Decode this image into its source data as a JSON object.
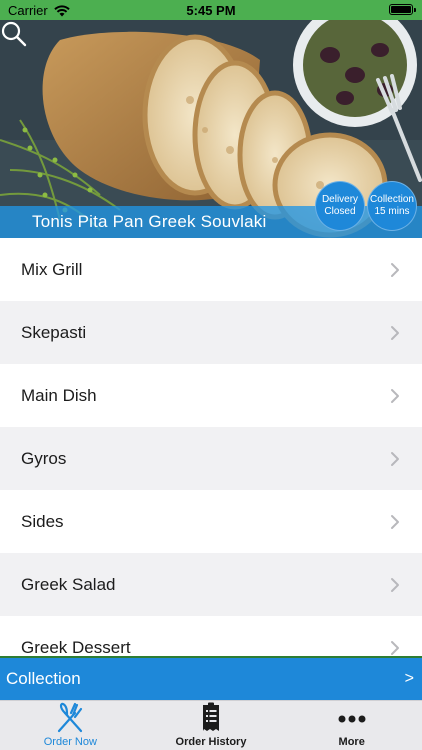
{
  "status_bar": {
    "carrier": "Carrier",
    "time": "5:45 PM",
    "battery_level": 1.0
  },
  "hero": {
    "restaurant_name": "Tonis Pita Pan Greek Souvlaki",
    "search_icon": "search-icon",
    "delivery_status": {
      "line1": "Delivery",
      "line2": "Closed"
    },
    "collection_status": {
      "line1": "Collection",
      "line2": "15 mins"
    }
  },
  "menu": {
    "categories": [
      {
        "label": "Mix Grill"
      },
      {
        "label": "Skepasti"
      },
      {
        "label": "Main Dish"
      },
      {
        "label": "Gyros"
      },
      {
        "label": "Sides"
      },
      {
        "label": "Greek Salad"
      },
      {
        "label": "Greek Dessert"
      }
    ]
  },
  "order_type_bar": {
    "label": "Collection",
    "arrow": ">"
  },
  "tab_bar": {
    "tabs": [
      {
        "label": "Order Now",
        "icon": "fork-knife-icon",
        "active": true
      },
      {
        "label": "Order History",
        "icon": "receipt-icon",
        "active": false
      },
      {
        "label": "More",
        "icon": "more-dots-icon",
        "active": false
      }
    ]
  },
  "colors": {
    "status_bar": "#4caf50",
    "accent_blue": "#1e88d9",
    "row_alt": "#f1f1f3",
    "tab_bar": "#e9e9ec"
  }
}
